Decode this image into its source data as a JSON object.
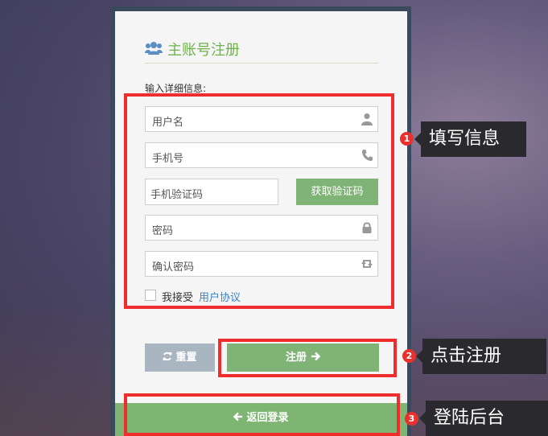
{
  "form": {
    "title": "主账号注册",
    "subtitle": "输入详细信息:",
    "username_placeholder": "用户名",
    "phone_placeholder": "手机号",
    "code_placeholder": "手机验证码",
    "get_code_label": "获取验证码",
    "password_placeholder": "密码",
    "confirm_placeholder": "确认密码",
    "agree_prefix": "我接受",
    "agree_link": "用户协议",
    "reset_label": "重置",
    "register_label": "注册",
    "back_label": "返回登录"
  },
  "annotations": [
    {
      "number": "1",
      "text": "填写信息"
    },
    {
      "number": "2",
      "text": "点击注册"
    },
    {
      "number": "3",
      "text": "登陆后台"
    }
  ],
  "icons": {
    "title": "users-icon",
    "username": "user-icon",
    "phone": "phone-icon",
    "password": "lock-icon",
    "confirm": "retweet-icon",
    "reset": "refresh-icon",
    "register": "arrow-right-icon",
    "back": "arrow-left-icon"
  },
  "colors": {
    "accent_green": "#80b476",
    "title_green": "#6fb24a",
    "link_blue": "#3a83c9",
    "annotation_red": "#f02d2d",
    "reset_gray": "#a9b6c2"
  }
}
